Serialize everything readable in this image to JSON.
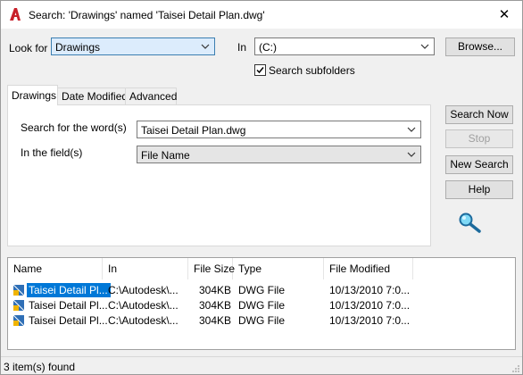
{
  "window": {
    "title": "Search: 'Drawings' named 'Taisei Detail Plan.dwg'",
    "close": "✕"
  },
  "lookfor": {
    "label": "Look for",
    "value": "Drawings"
  },
  "in": {
    "label": "In",
    "value": "(C:)",
    "browse": "Browse..."
  },
  "search_subfolders": {
    "label": "Search subfolders",
    "checked": true
  },
  "tabs": [
    "Drawings",
    "Date Modified",
    "Advanced"
  ],
  "drawings_tab": {
    "search_word_label": "Search for the word(s)",
    "search_word_value": "Taisei Detail Plan.dwg",
    "field_label": "In the field(s)",
    "field_value": "File Name"
  },
  "buttons": {
    "search_now": "Search Now",
    "stop": "Stop",
    "new_search": "New Search",
    "help": "Help"
  },
  "results": {
    "columns": [
      "Name",
      "In",
      "File Size",
      "Type",
      "File Modified"
    ],
    "rows": [
      {
        "name": "Taisei Detail Pl...",
        "in": "C:\\Autodesk\\...",
        "size": "304KB",
        "type": "DWG File",
        "modified": "10/13/2010 7:0..."
      },
      {
        "name": "Taisei Detail Pl...",
        "in": "C:\\Autodesk\\...",
        "size": "304KB",
        "type": "DWG File",
        "modified": "10/13/2010 7:0..."
      },
      {
        "name": "Taisei Detail Pl...",
        "in": "C:\\Autodesk\\...",
        "size": "304KB",
        "type": "DWG File",
        "modified": "10/13/2010 7:0..."
      }
    ]
  },
  "status": "3 item(s) found",
  "colors": {
    "accent": "#0078d7",
    "selection_field": "#dcecfc",
    "app_icon": "#c8202a"
  }
}
